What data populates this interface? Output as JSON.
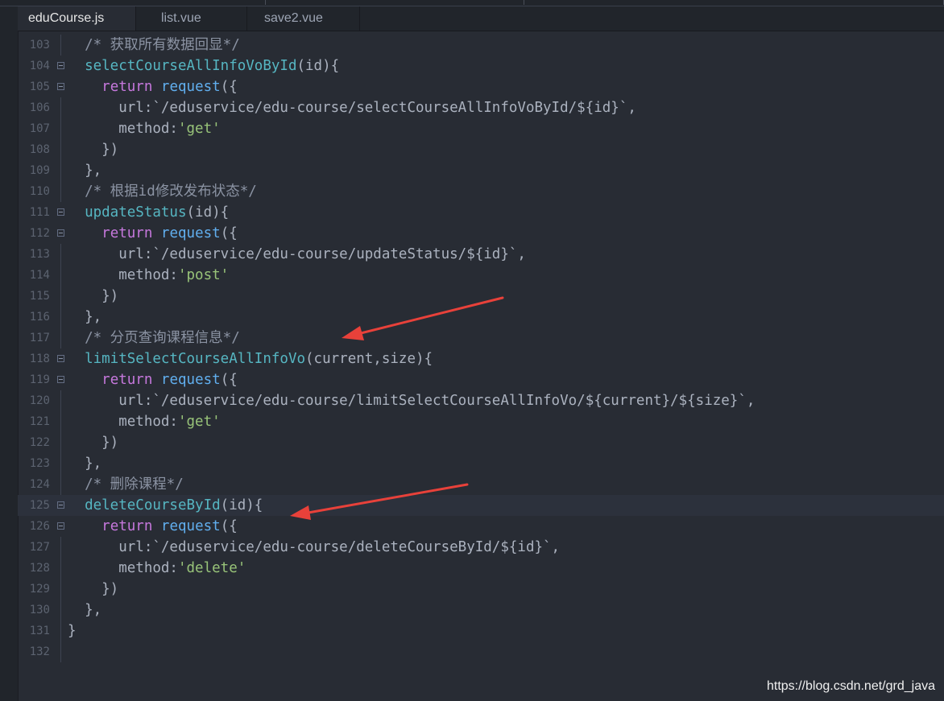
{
  "tabs": [
    {
      "label": "eduCourse.js",
      "active": true
    },
    {
      "label": "list.vue",
      "active": false
    },
    {
      "label": "save2.vue",
      "active": false
    }
  ],
  "lines": [
    {
      "num": "103",
      "segs": [
        [
          "comment",
          "/* 获取所有数据回显*/"
        ]
      ]
    },
    {
      "num": "104",
      "segs": [
        [
          "fn",
          "selectCourseAllInfoVoById"
        ],
        [
          "plain",
          "(id){"
        ]
      ]
    },
    {
      "num": "105",
      "segs": [
        [
          "plain",
          "  "
        ],
        [
          "kw",
          "return"
        ],
        [
          "plain",
          " "
        ],
        [
          "call",
          "request"
        ],
        [
          "plain",
          "({"
        ]
      ]
    },
    {
      "num": "106",
      "segs": [
        [
          "plain",
          "    url:`/eduservice/edu-course/selectCourseAllInfoVoById/${id}`,"
        ]
      ]
    },
    {
      "num": "107",
      "segs": [
        [
          "plain",
          "    method:"
        ],
        [
          "str",
          "'get'"
        ]
      ]
    },
    {
      "num": "108",
      "segs": [
        [
          "plain",
          "  })"
        ]
      ]
    },
    {
      "num": "109",
      "segs": [
        [
          "plain",
          "},"
        ]
      ]
    },
    {
      "num": "110",
      "segs": [
        [
          "comment",
          "/* 根据id修改发布状态*/"
        ]
      ]
    },
    {
      "num": "111",
      "segs": [
        [
          "fn",
          "updateStatus"
        ],
        [
          "plain",
          "(id){"
        ]
      ]
    },
    {
      "num": "112",
      "segs": [
        [
          "plain",
          "  "
        ],
        [
          "kw",
          "return"
        ],
        [
          "plain",
          " "
        ],
        [
          "call",
          "request"
        ],
        [
          "plain",
          "({"
        ]
      ]
    },
    {
      "num": "113",
      "segs": [
        [
          "plain",
          "    url:`/eduservice/edu-course/updateStatus/${id}`,"
        ]
      ]
    },
    {
      "num": "114",
      "segs": [
        [
          "plain",
          "    method:"
        ],
        [
          "str",
          "'post'"
        ]
      ]
    },
    {
      "num": "115",
      "segs": [
        [
          "plain",
          "  })"
        ]
      ]
    },
    {
      "num": "116",
      "segs": [
        [
          "plain",
          "},"
        ]
      ]
    },
    {
      "num": "117",
      "segs": [
        [
          "comment",
          "/* 分页查询课程信息*/"
        ]
      ]
    },
    {
      "num": "118",
      "segs": [
        [
          "fn",
          "limitSelectCourseAllInfoVo"
        ],
        [
          "plain",
          "(current,size){"
        ]
      ]
    },
    {
      "num": "119",
      "segs": [
        [
          "plain",
          "  "
        ],
        [
          "kw",
          "return"
        ],
        [
          "plain",
          " "
        ],
        [
          "call",
          "request"
        ],
        [
          "plain",
          "({"
        ]
      ]
    },
    {
      "num": "120",
      "segs": [
        [
          "plain",
          "    url:`/eduservice/edu-course/limitSelectCourseAllInfoVo/${current}/${size}`,"
        ]
      ]
    },
    {
      "num": "121",
      "segs": [
        [
          "plain",
          "    method:"
        ],
        [
          "str",
          "'get'"
        ]
      ]
    },
    {
      "num": "122",
      "segs": [
        [
          "plain",
          "  })"
        ]
      ]
    },
    {
      "num": "123",
      "segs": [
        [
          "plain",
          "},"
        ]
      ]
    },
    {
      "num": "124",
      "segs": [
        [
          "comment",
          "/* 删除课程*/"
        ]
      ]
    },
    {
      "num": "125",
      "segs": [
        [
          "fn",
          "deleteCourseById"
        ],
        [
          "plain",
          "(id){"
        ]
      ]
    },
    {
      "num": "126",
      "segs": [
        [
          "plain",
          "  "
        ],
        [
          "kw",
          "return"
        ],
        [
          "plain",
          " "
        ],
        [
          "call",
          "request"
        ],
        [
          "plain",
          "({"
        ]
      ]
    },
    {
      "num": "127",
      "segs": [
        [
          "plain",
          "    url:`/eduservice/edu-course/deleteCourseById/${id}`,"
        ]
      ]
    },
    {
      "num": "128",
      "segs": [
        [
          "plain",
          "    method:"
        ],
        [
          "str",
          "'delete'"
        ]
      ]
    },
    {
      "num": "129",
      "segs": [
        [
          "plain",
          "  })"
        ]
      ]
    },
    {
      "num": "130",
      "segs": [
        [
          "plain",
          "},"
        ]
      ]
    },
    {
      "num": "131",
      "segs": [
        [
          "plain",
          "}"
        ]
      ]
    },
    {
      "num": "132",
      "segs": []
    }
  ],
  "watermark": "https://blog.csdn.net/grd_java",
  "colors": {
    "background": "#282c34",
    "comment": "#8b93a3",
    "function": "#56b6c2",
    "keyword": "#c678dd",
    "call": "#61afef",
    "string": "#98c379",
    "arrow": "#e8413a"
  }
}
